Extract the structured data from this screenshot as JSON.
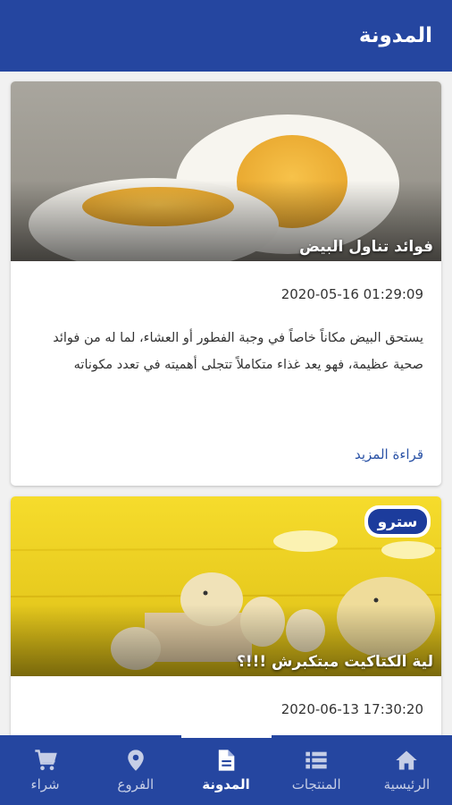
{
  "header": {
    "title": "المدونة"
  },
  "posts": [
    {
      "title": "فوائد تناول البيض",
      "date": "2020-05-16 01:29:09",
      "excerpt": "يستحق البيض مكاناً خاصاً في وجبة الفطور أو العشاء، لما له من فوائد صحية عظيمة، فهو يعد غذاء متكاملاً تتجلى أهميته في تعدد مكوناته",
      "read_more": "قراءة المزيد",
      "image_icon": "boiled-egg-photo"
    },
    {
      "title": "لية الكتاكيت مبتكبرش !!!؟",
      "date": "2020-06-13 17:30:20",
      "logo_text": "سترو",
      "image_icon": "chicks-photo"
    }
  ],
  "bottom_nav": {
    "items": [
      {
        "label": "الرئيسية",
        "icon": "home-icon"
      },
      {
        "label": "المنتجات",
        "icon": "list-icon"
      },
      {
        "label": "المدونة",
        "icon": "document-icon",
        "active": true
      },
      {
        "label": "الفروع",
        "icon": "location-pin-icon"
      },
      {
        "label": "شراء",
        "icon": "cart-icon"
      }
    ]
  },
  "colors": {
    "primary": "#2546a0",
    "link": "#2b53a6",
    "background": "#f1f1f1"
  }
}
